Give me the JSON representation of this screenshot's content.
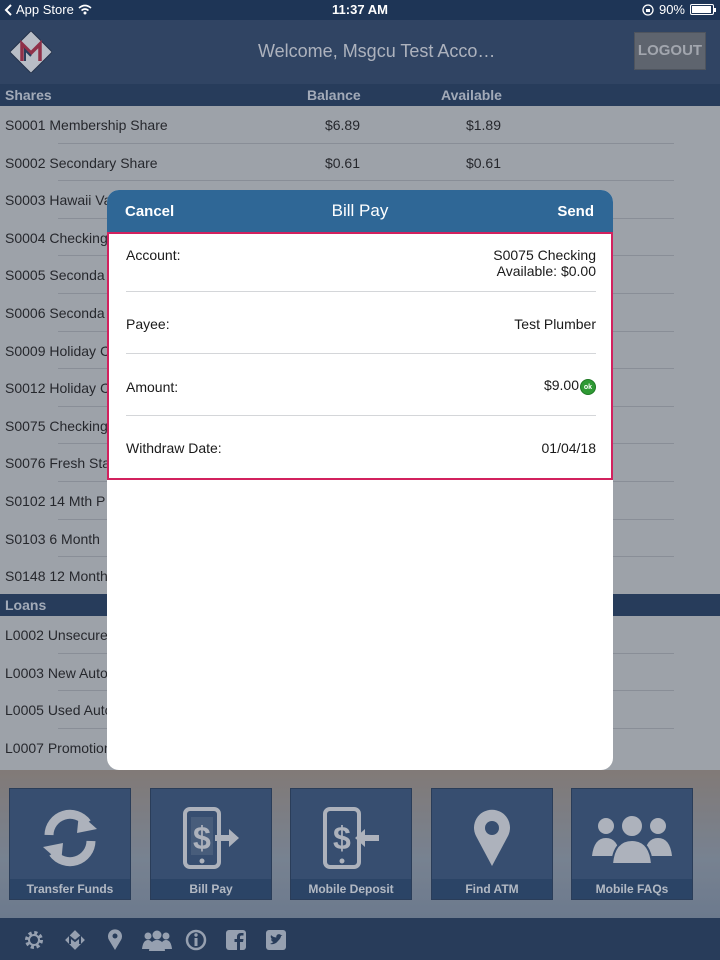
{
  "status_bar": {
    "back_app": "App Store",
    "time": "11:37 AM",
    "battery": "90%"
  },
  "header": {
    "welcome": "Welcome, Msgcu Test Acco…",
    "logout_label": "LOGOUT"
  },
  "shares": {
    "title": "Shares",
    "col_balance": "Balance",
    "col_available": "Available",
    "rows": [
      {
        "name": "S0001 Membership Share",
        "balance": "$6.89",
        "available": "$1.89"
      },
      {
        "name": "S0002 Secondary Share",
        "balance": "$0.61",
        "available": "$0.61"
      },
      {
        "name": "S0003 Hawaii Va",
        "balance": "",
        "available": ""
      },
      {
        "name": "S0004 Checking",
        "balance": "",
        "available": ""
      },
      {
        "name": "S0005 Seconda",
        "balance": "",
        "available": ""
      },
      {
        "name": "S0006 Seconda",
        "balance": "",
        "available": ""
      },
      {
        "name": "S0009 Holiday C",
        "balance": "",
        "available": ""
      },
      {
        "name": "S0012 Holiday C",
        "balance": "",
        "available": ""
      },
      {
        "name": "S0075 Checking",
        "balance": "",
        "available": ""
      },
      {
        "name": "S0076 Fresh Sta",
        "balance": "",
        "available": ""
      },
      {
        "name": "S0102 14 Mth P",
        "balance": "",
        "available": ""
      },
      {
        "name": "S0103 6 Month",
        "balance": "",
        "available": ""
      },
      {
        "name": "S0148 12 Month",
        "balance": "",
        "available": ""
      }
    ]
  },
  "loans": {
    "title": "Loans",
    "rows": [
      {
        "name": "L0002 Unsecure"
      },
      {
        "name": "L0003 New Auto"
      },
      {
        "name": "L0005 Used Auto"
      },
      {
        "name": "L0007 Promotion"
      }
    ]
  },
  "modal": {
    "cancel": "Cancel",
    "title": "Bill Pay",
    "send": "Send",
    "account_label": "Account:",
    "account_value": "S0075 Checking",
    "account_available": "Available: $0.00",
    "payee_label": "Payee:",
    "payee_value": "Test Plumber",
    "amount_label": "Amount:",
    "amount_value": "$9.00",
    "amount_badge": "ok",
    "date_label": "Withdraw Date:",
    "date_value": "01/04/18"
  },
  "tiles": [
    {
      "label": "Transfer Funds",
      "icon": "refresh-icon"
    },
    {
      "label": "Bill Pay",
      "icon": "phone-dollar-out-icon"
    },
    {
      "label": "Mobile Deposit",
      "icon": "phone-dollar-in-icon"
    },
    {
      "label": "Find ATM",
      "icon": "map-pin-icon"
    },
    {
      "label": "Mobile FAQs",
      "icon": "group-icon"
    }
  ],
  "footer_icons": [
    "gear-icon",
    "logo-icon",
    "location-icon",
    "people-icon",
    "info-icon",
    "facebook-icon",
    "twitter-icon"
  ],
  "colors": {
    "header": "#2c4569",
    "modal_header": "#2f6796",
    "highlight": "#d2215e",
    "tile": "#35537a"
  }
}
